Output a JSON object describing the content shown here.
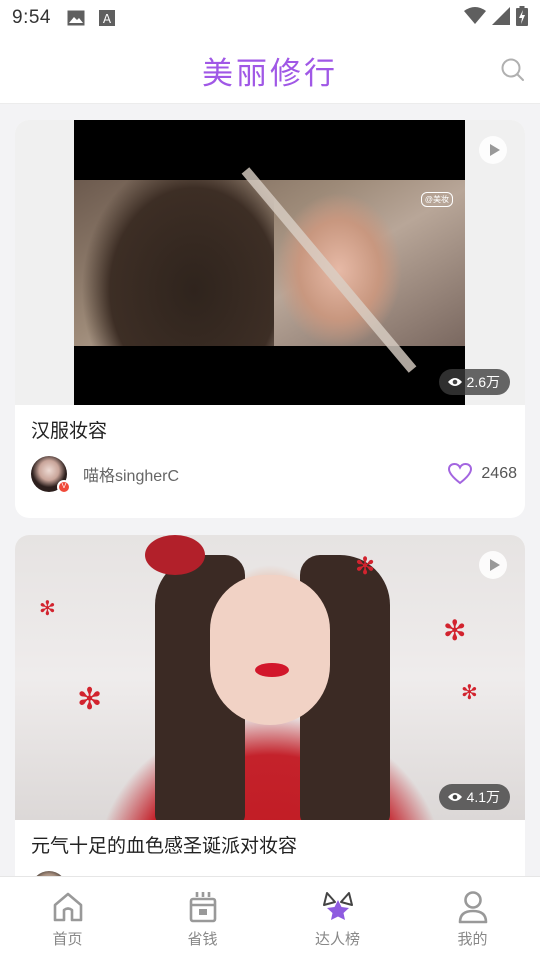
{
  "status_bar": {
    "time": "9:54",
    "left_icons": [
      "image-icon",
      "text-icon"
    ],
    "right_icons": [
      "wifi-icon",
      "signal-icon",
      "battery-icon"
    ]
  },
  "header": {
    "title": "美丽修行",
    "search_icon": "search-icon",
    "title_color": "#a058e6"
  },
  "feed": {
    "cards": [
      {
        "title": "汉服妆容",
        "views": "2.6万",
        "author": "喵格singherC",
        "likes": "2468",
        "watermark": "@美妆"
      },
      {
        "title": "元气十足的血色感圣诞派对妆容",
        "views": "4.1万"
      }
    ]
  },
  "tabs": [
    {
      "label": "首页",
      "icon": "home-icon"
    },
    {
      "label": "省钱",
      "icon": "savings-icon"
    },
    {
      "label": "达人榜",
      "icon": "star-ranking-icon"
    },
    {
      "label": "我的",
      "icon": "user-icon"
    }
  ],
  "colors": {
    "accent": "#a058e6",
    "heart": "#a365e0",
    "badge": "#f04a3a"
  }
}
